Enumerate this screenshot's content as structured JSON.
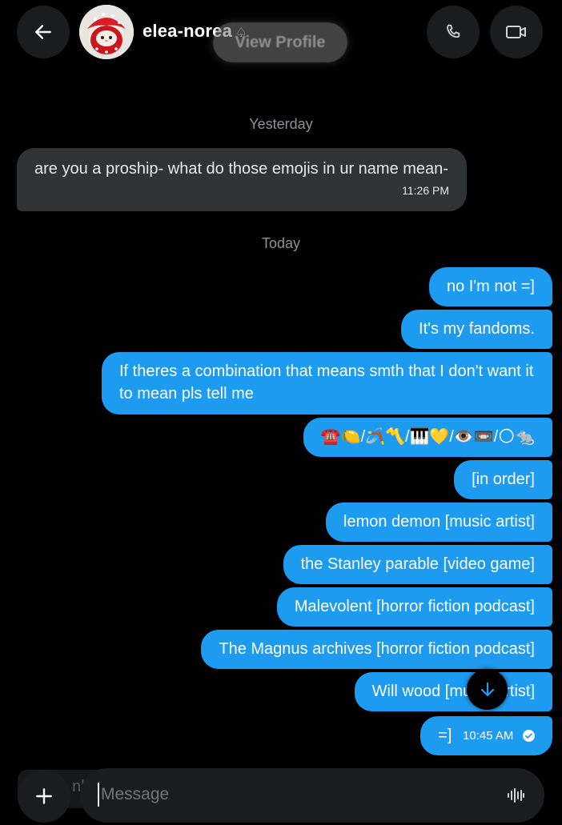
{
  "header": {
    "username": "elea-norea",
    "badge": "♤",
    "view_profile_label": "View Profile",
    "icons": [
      "arrow-left-icon",
      "phone-icon",
      "video-camera-icon"
    ]
  },
  "thread": {
    "dividers": {
      "yesterday": "Yesterday",
      "today": "Today"
    },
    "incoming": [
      {
        "text": "are you a proship- what do those emojis in ur name mean-",
        "time": "11:26 PM"
      }
    ],
    "outgoing": [
      "no I'm not  =]",
      "It's my fandoms.",
      "If theres a combination that means smth that I don't want it to mean pls tell me",
      "☎️🍋/🪃〽️/🎹💛/👁️📼/🌕🐀",
      "[in order]",
      "lemon demon [music artist]",
      "the Stanley parable [video game]",
      "Malevolent [horror fiction podcast]",
      "The Magnus archives [horror fiction podcast]",
      "Will wood [music artist]"
    ],
    "last_message": {
      "text": "=]",
      "time": "10:45 AM",
      "status_icon": "read-check-icon"
    }
  },
  "composer": {
    "placeholder": "Message",
    "ghost_chip_text": "nh"
  },
  "colors": {
    "background": "#000000",
    "outgoing_bubble": "#1d9bf0",
    "incoming_bubble": "#2f3336",
    "secondary_text": "#8b9298"
  }
}
